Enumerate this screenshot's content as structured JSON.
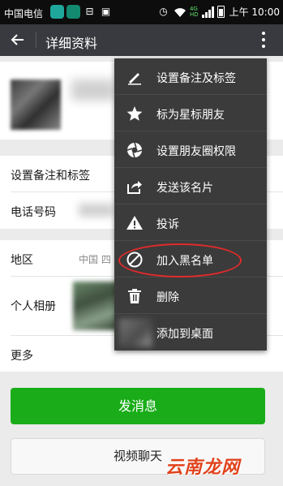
{
  "statusbar": {
    "carrier": "中国电信",
    "net_top": "4G",
    "net_bottom": "HD",
    "time": "上午 10:00"
  },
  "topbar": {
    "title": "详细资料",
    "back_icon": "arrow-left-icon",
    "more_icon": "more-vertical-icon"
  },
  "rows": {
    "remark": "设置备注和标签",
    "phone": "电话号码",
    "region": "地区",
    "region_value": "中国  四",
    "album": "个人相册",
    "more": "更多"
  },
  "buttons": {
    "send_message": "发消息",
    "video_call": "视频聊天"
  },
  "menu": {
    "items": [
      {
        "label": "设置备注及标签",
        "icon": "pencil-icon"
      },
      {
        "label": "标为星标朋友",
        "icon": "star-icon"
      },
      {
        "label": "设置朋友圈权限",
        "icon": "aperture-icon"
      },
      {
        "label": "发送该名片",
        "icon": "share-icon"
      },
      {
        "label": "投诉",
        "icon": "warning-icon"
      },
      {
        "label": "加入黑名单",
        "icon": "block-icon"
      },
      {
        "label": "删除",
        "icon": "trash-icon"
      },
      {
        "label": "添加到桌面",
        "icon": "desktop-icon"
      }
    ]
  },
  "watermark": "云南龙网",
  "colors": {
    "accent_green": "#1aad19",
    "topbar": "#393a3f",
    "menu_bg": "#3b3b3b",
    "highlight_red": "#e02a2a",
    "watermark_red": "#e0421b"
  }
}
